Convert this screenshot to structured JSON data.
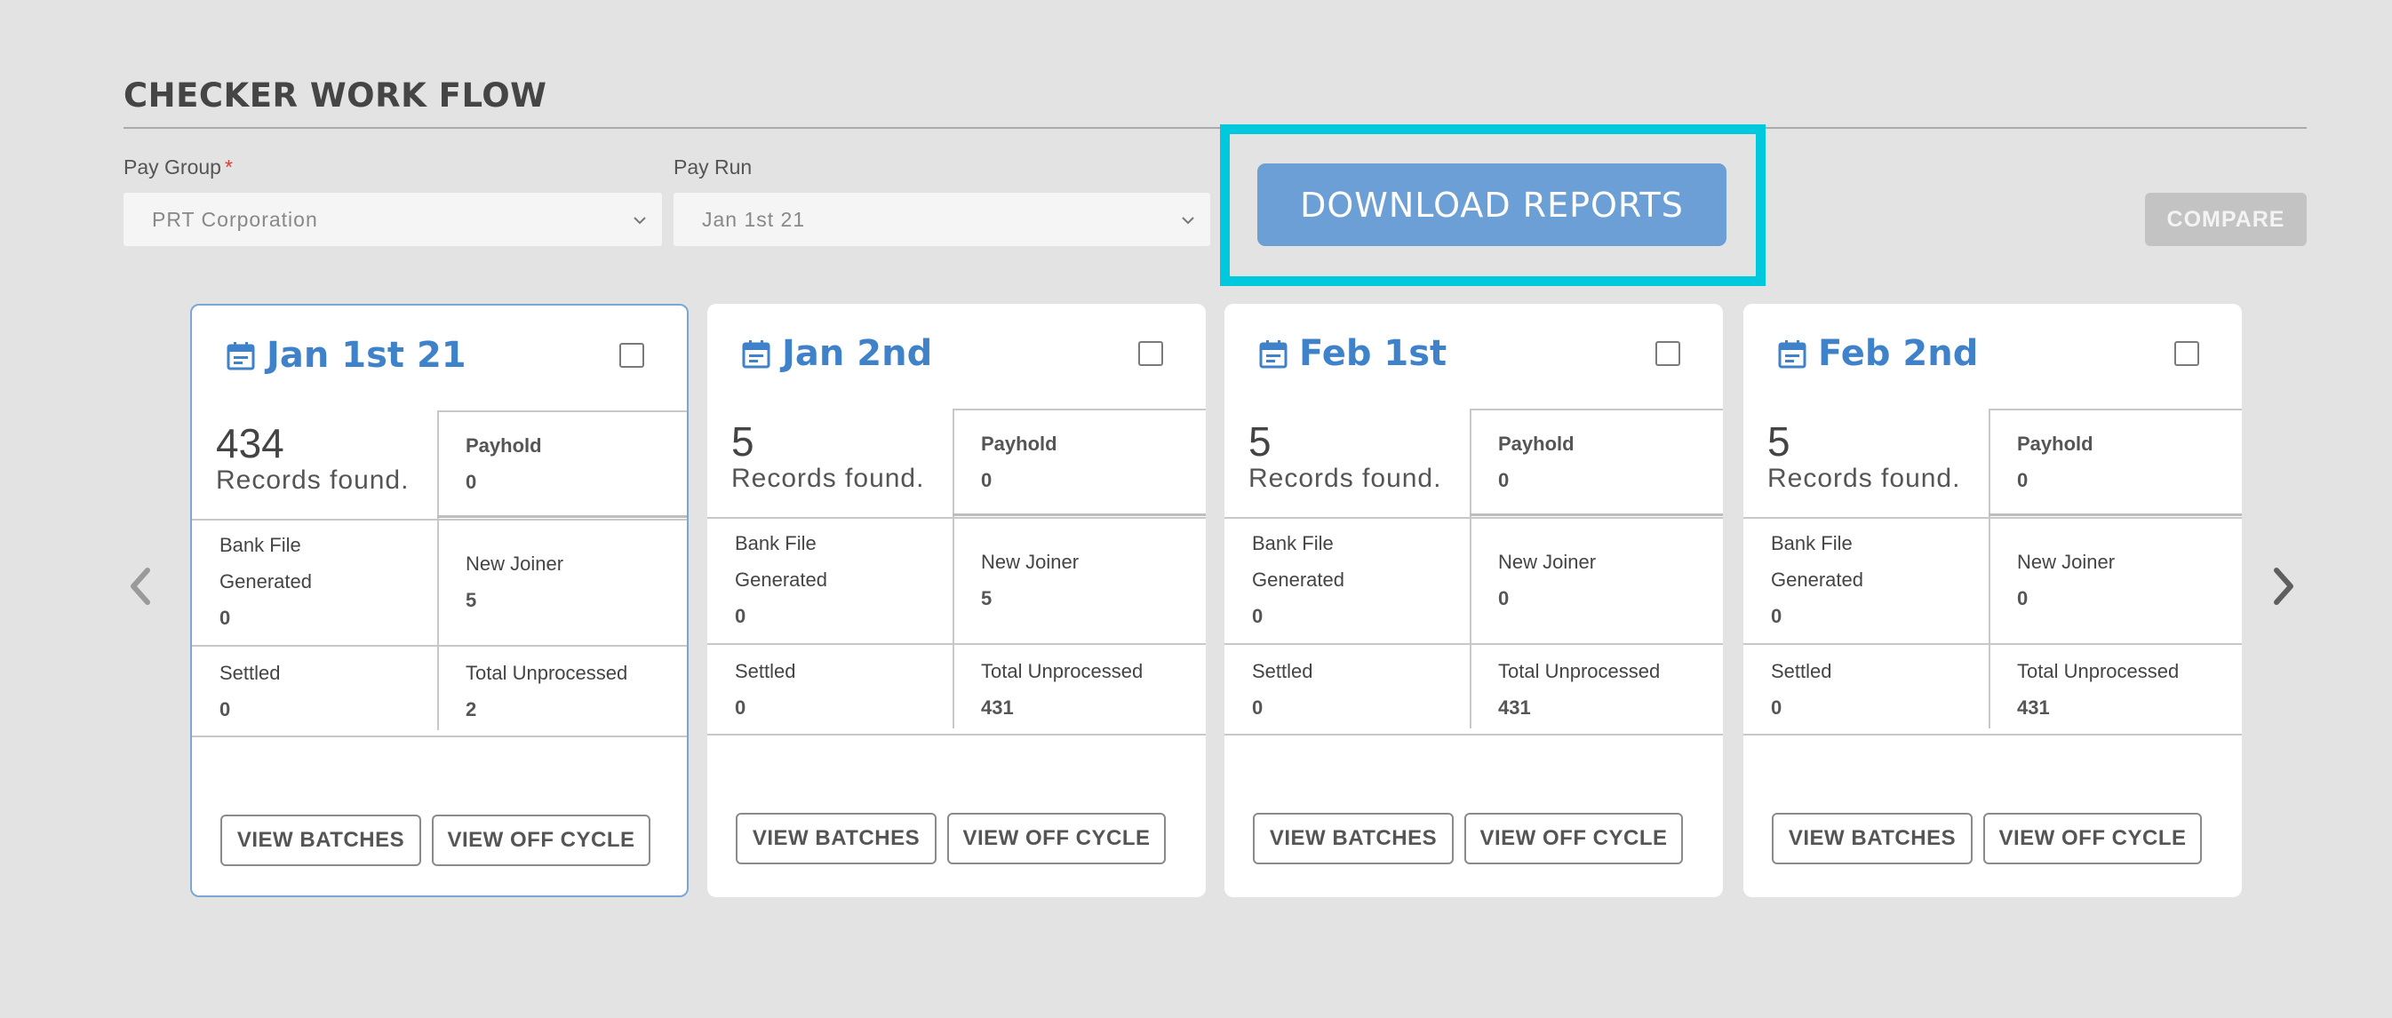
{
  "page": {
    "title": "CHECKER WORK FLOW"
  },
  "filters": {
    "pay_group": {
      "label": "Pay Group",
      "required_mark": "*",
      "value": "PRT Corporation"
    },
    "pay_run": {
      "label": "Pay Run",
      "value": "Jan 1st 21"
    }
  },
  "actions": {
    "download_reports": "DOWNLOAD REPORTS",
    "compare": "COMPARE"
  },
  "colors": {
    "accent": "#3f82c9",
    "download_bg": "#6b9fd6",
    "highlight": "#00c9dd",
    "required": "#e53935"
  },
  "cards": [
    {
      "date": "Jan 1st 21",
      "records": "434",
      "records_label": "Records found.",
      "payhold_label": "Payhold",
      "payhold": "0",
      "bank_file_label_1": "Bank File",
      "bank_file_label_2": "Generated",
      "bank_file": "0",
      "new_joiner_label": "New Joiner",
      "new_joiner": "5",
      "settled_label": "Settled",
      "settled": "0",
      "total_unprocessed_label": "Total Unprocessed",
      "total_unprocessed": "2",
      "view_batches": "VIEW BATCHES",
      "view_off_cycle": "VIEW OFF CYCLE"
    },
    {
      "date": "Jan 2nd",
      "records": "5",
      "records_label": "Records found.",
      "payhold_label": "Payhold",
      "payhold": "0",
      "bank_file_label_1": "Bank File",
      "bank_file_label_2": "Generated",
      "bank_file": "0",
      "new_joiner_label": "New Joiner",
      "new_joiner": "5",
      "settled_label": "Settled",
      "settled": "0",
      "total_unprocessed_label": "Total Unprocessed",
      "total_unprocessed": "431",
      "view_batches": "VIEW BATCHES",
      "view_off_cycle": "VIEW OFF CYCLE"
    },
    {
      "date": "Feb 1st",
      "records": "5",
      "records_label": "Records found.",
      "payhold_label": "Payhold",
      "payhold": "0",
      "bank_file_label_1": "Bank File",
      "bank_file_label_2": "Generated",
      "bank_file": "0",
      "new_joiner_label": "New Joiner",
      "new_joiner": "0",
      "settled_label": "Settled",
      "settled": "0",
      "total_unprocessed_label": "Total Unprocessed",
      "total_unprocessed": "431",
      "view_batches": "VIEW BATCHES",
      "view_off_cycle": "VIEW OFF CYCLE"
    },
    {
      "date": "Feb 2nd",
      "records": "5",
      "records_label": "Records found.",
      "payhold_label": "Payhold",
      "payhold": "0",
      "bank_file_label_1": "Bank File",
      "bank_file_label_2": "Generated",
      "bank_file": "0",
      "new_joiner_label": "New Joiner",
      "new_joiner": "0",
      "settled_label": "Settled",
      "settled": "0",
      "total_unprocessed_label": "Total Unprocessed",
      "total_unprocessed": "431",
      "view_batches": "VIEW BATCHES",
      "view_off_cycle": "VIEW OFF CYCLE"
    }
  ]
}
